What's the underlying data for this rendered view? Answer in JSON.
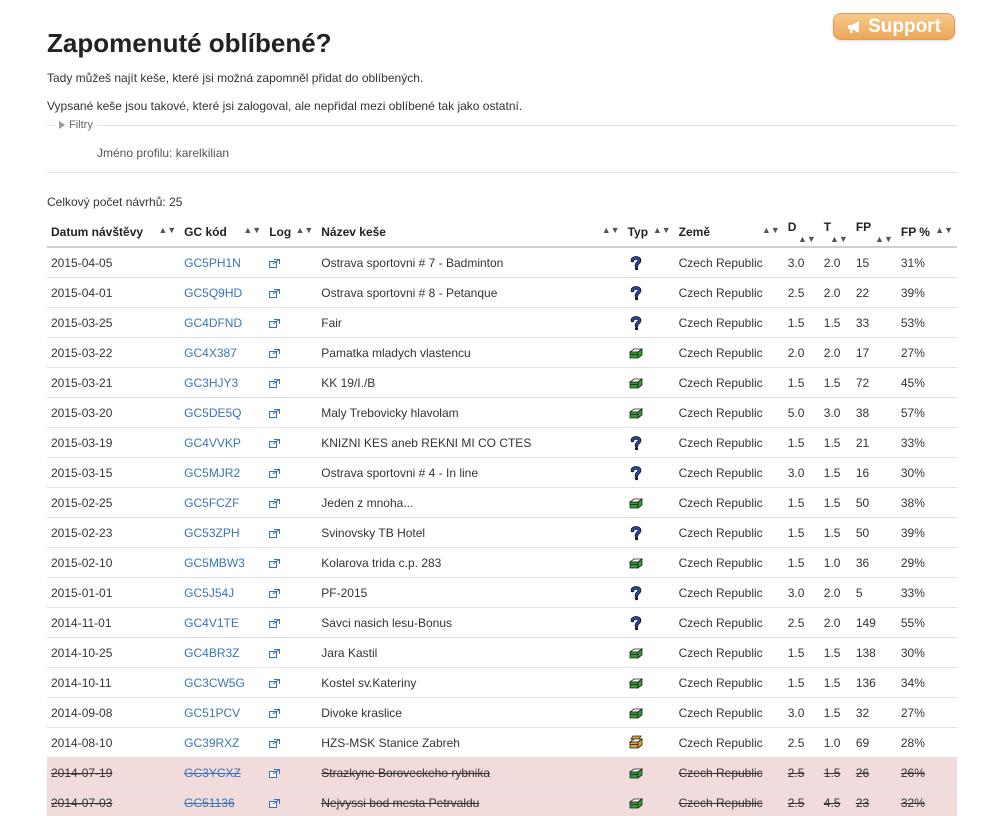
{
  "support": {
    "label": "Support",
    "icon": "megaphone-icon"
  },
  "title": "Zapomenuté oblíbené?",
  "desc1": "Tady můžeš najít keše, které jsi možná zapomněl přidat do oblíbených.",
  "desc2": "Vypsané keše jsou takové, které jsi zalogoval, ale nepřidal mezi oblíbené tak jako ostatní.",
  "filters": {
    "label": "Filtry",
    "profile": "Jméno profilu: karelkilian"
  },
  "total": "Celkový počet návrhů: 25",
  "table": {
    "headers": [
      "Datum návštěvy",
      "GC kód",
      "Log",
      "Název keše",
      "Typ",
      "Země",
      "D",
      "T",
      "FP",
      "FP %"
    ],
    "rows": [
      {
        "date": "2015-04-05",
        "gc": "GC5PH1N",
        "name": "Ostrava sportovni # 7 - Badminton",
        "type": "mystery",
        "country": "Czech Republic",
        "d": "3.0",
        "t": "2.0",
        "fp": "15",
        "fpp": "31%"
      },
      {
        "date": "2015-04-01",
        "gc": "GC5Q9HD",
        "name": "Ostrava sportovni # 8 - Petanque",
        "type": "mystery",
        "country": "Czech Republic",
        "d": "2.5",
        "t": "2.0",
        "fp": "22",
        "fpp": "39%"
      },
      {
        "date": "2015-03-25",
        "gc": "GC4DFND",
        "name": "Fair",
        "type": "mystery",
        "country": "Czech Republic",
        "d": "1.5",
        "t": "1.5",
        "fp": "33",
        "fpp": "53%"
      },
      {
        "date": "2015-03-22",
        "gc": "GC4X387",
        "name": "Pamatka mladych vlastencu",
        "type": "traditional",
        "country": "Czech Republic",
        "d": "2.0",
        "t": "2.0",
        "fp": "17",
        "fpp": "27%"
      },
      {
        "date": "2015-03-21",
        "gc": "GC3HJY3",
        "name": "KK 19/I./B",
        "type": "traditional",
        "country": "Czech Republic",
        "d": "1.5",
        "t": "1.5",
        "fp": "72",
        "fpp": "45%"
      },
      {
        "date": "2015-03-20",
        "gc": "GC5DE5Q",
        "name": "Maly Trebovicky hlavolam",
        "type": "traditional",
        "country": "Czech Republic",
        "d": "5.0",
        "t": "3.0",
        "fp": "38",
        "fpp": "57%"
      },
      {
        "date": "2015-03-19",
        "gc": "GC4VVKP",
        "name": "KNIZNI KES aneb REKNI MI CO CTES",
        "type": "mystery",
        "country": "Czech Republic",
        "d": "1.5",
        "t": "1.5",
        "fp": "21",
        "fpp": "33%"
      },
      {
        "date": "2015-03-15",
        "gc": "GC5MJR2",
        "name": "Ostrava sportovni # 4 - In line",
        "type": "mystery",
        "country": "Czech Republic",
        "d": "3.0",
        "t": "1.5",
        "fp": "16",
        "fpp": "30%"
      },
      {
        "date": "2015-02-25",
        "gc": "GC5FCZF",
        "name": "Jeden z mnoha...",
        "type": "traditional",
        "country": "Czech Republic",
        "d": "1.5",
        "t": "1.5",
        "fp": "50",
        "fpp": "38%"
      },
      {
        "date": "2015-02-23",
        "gc": "GC53ZPH",
        "name": "Svinovsky TB Hotel",
        "type": "mystery",
        "country": "Czech Republic",
        "d": "1.5",
        "t": "1.5",
        "fp": "50",
        "fpp": "39%"
      },
      {
        "date": "2015-02-10",
        "gc": "GC5MBW3",
        "name": "Kolarova trida c.p. 283",
        "type": "traditional",
        "country": "Czech Republic",
        "d": "1.5",
        "t": "1.0",
        "fp": "36",
        "fpp": "29%"
      },
      {
        "date": "2015-01-01",
        "gc": "GC5J54J",
        "name": "PF-2015",
        "type": "mystery",
        "country": "Czech Republic",
        "d": "3.0",
        "t": "2.0",
        "fp": "5",
        "fpp": "33%"
      },
      {
        "date": "2014-11-01",
        "gc": "GC4V1TE",
        "name": "Savci nasich lesu-Bonus",
        "type": "mystery",
        "country": "Czech Republic",
        "d": "2.5",
        "t": "2.0",
        "fp": "149",
        "fpp": "55%"
      },
      {
        "date": "2014-10-25",
        "gc": "GC4BR3Z",
        "name": "Jara Kastil",
        "type": "traditional",
        "country": "Czech Republic",
        "d": "1.5",
        "t": "1.5",
        "fp": "138",
        "fpp": "30%"
      },
      {
        "date": "2014-10-11",
        "gc": "GC3CW5G",
        "name": "Kostel sv.Kateriny",
        "type": "traditional",
        "country": "Czech Republic",
        "d": "1.5",
        "t": "1.5",
        "fp": "136",
        "fpp": "34%"
      },
      {
        "date": "2014-09-08",
        "gc": "GC51PCV",
        "name": "Divoke kraslice",
        "type": "traditional",
        "country": "Czech Republic",
        "d": "3.0",
        "t": "1.5",
        "fp": "32",
        "fpp": "27%"
      },
      {
        "date": "2014-08-10",
        "gc": "GC39RXZ",
        "name": "HZS-MSK Stanice Zabreh",
        "type": "multi",
        "country": "Czech Republic",
        "d": "2.5",
        "t": "1.0",
        "fp": "69",
        "fpp": "28%"
      },
      {
        "date": "2014-07-19",
        "gc": "GC3YCXZ",
        "name": "Strazkyne Boroveckeho rybnika",
        "type": "traditional",
        "country": "Czech Republic",
        "d": "2.5",
        "t": "1.5",
        "fp": "26",
        "fpp": "26%",
        "ignored": true
      },
      {
        "date": "2014-07-03",
        "gc": "GC51136",
        "name": "Nejvyssi bod mesta Petrvaldu",
        "type": "traditional",
        "country": "Czech Republic",
        "d": "2.5",
        "t": "4.5",
        "fp": "23",
        "fpp": "32%",
        "ignored": true
      }
    ]
  },
  "colors": {
    "support": "#eda759",
    "link": "#3b73b9",
    "ignored_row": "#f1dbdb",
    "traditional": "#2f9e2f",
    "multi": "#e0a52c",
    "mystery": "#2a46b8"
  }
}
